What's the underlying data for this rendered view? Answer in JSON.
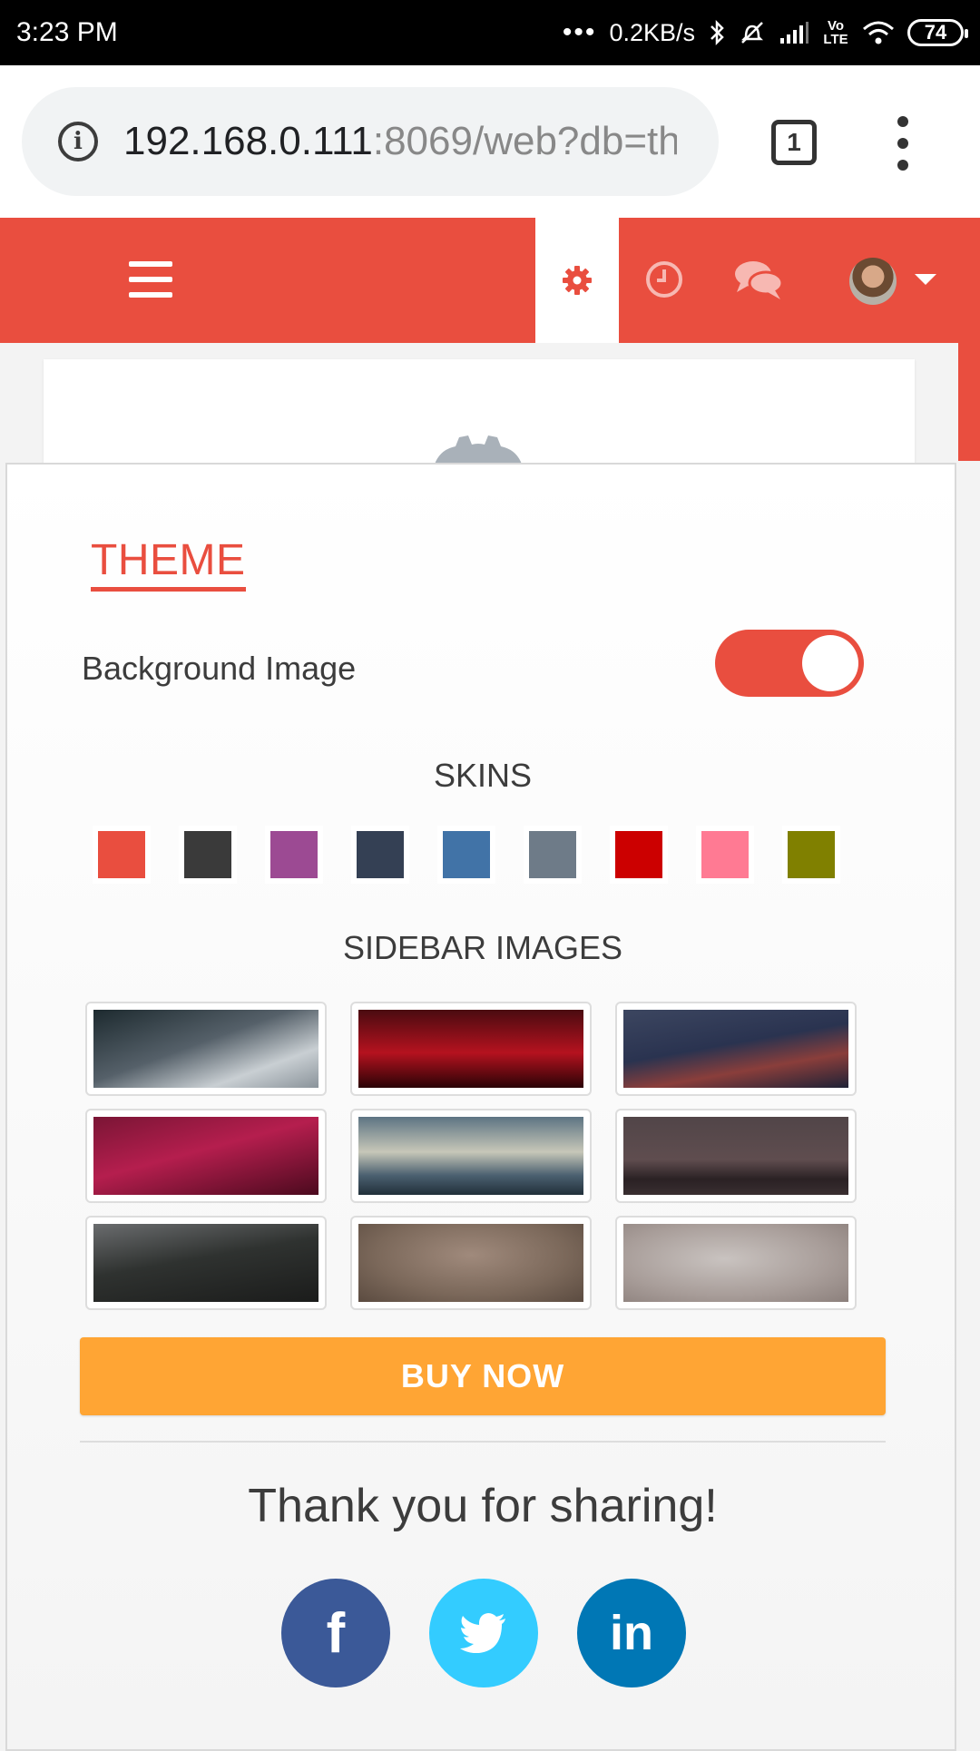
{
  "status_bar": {
    "time": "3:23 PM",
    "speed": "0.2KB/s",
    "network_label": "Vo LTE",
    "battery": "74"
  },
  "browser": {
    "url_host": "192.168.0.111",
    "url_path": ":8069/web?db=th",
    "tab_count": "1"
  },
  "panel": {
    "theme_title": "THEME",
    "background_image_label": "Background Image",
    "background_image_on": true,
    "skins_title": "SKINS",
    "skins": [
      "#e94e3f",
      "#3a3a3a",
      "#9c4a93",
      "#344054",
      "#4173a7",
      "#6e7b88",
      "#cc0000",
      "#ff7a93",
      "#808000"
    ],
    "sidebar_images_title": "SIDEBAR IMAGES",
    "sidebar_images": [
      "linear-gradient(160deg,#1d2a2f 0%,#556069 45%,#c9cfd3 75%,#8a939a 100%)",
      "linear-gradient(180deg,#4a0b10 0%,#b5121f 55%,#2a0306 100%)",
      "linear-gradient(170deg,#3c4660 0%,#2a3350 45%,#8a3e3b 70%,#1f2236 100%)",
      "linear-gradient(165deg,#7a1535 0%,#b51e4e 45%,#4b0a1e 100%)",
      "linear-gradient(180deg,#5d7483 0%,#c7c7b8 45%,#4b6070 75%,#21303a 100%)",
      "linear-gradient(180deg,#514548 0%,#5f4d4f 55%,#2a2124 80%,#3a2f31 100%)",
      "linear-gradient(170deg,#6a6c6e 0%,#2f3230 45%,#1b1c1b 100%)",
      "radial-gradient(ellipse at 50% 40%,#a08a7c 0%,#7b685a 60%,#5b4b40 100%)",
      "radial-gradient(ellipse at 45% 45%,#c9c3c0 0%,#a89d99 60%,#8c807c 100%)"
    ],
    "buy_label": "BUY NOW",
    "thanks": "Thank you for sharing!",
    "social": [
      {
        "name": "facebook",
        "glyph": "f",
        "color": "#3b5998"
      },
      {
        "name": "twitter",
        "glyph": "🐦",
        "color": "#33ccff"
      },
      {
        "name": "linkedin",
        "glyph": "in",
        "color": "#0077b5"
      }
    ]
  }
}
